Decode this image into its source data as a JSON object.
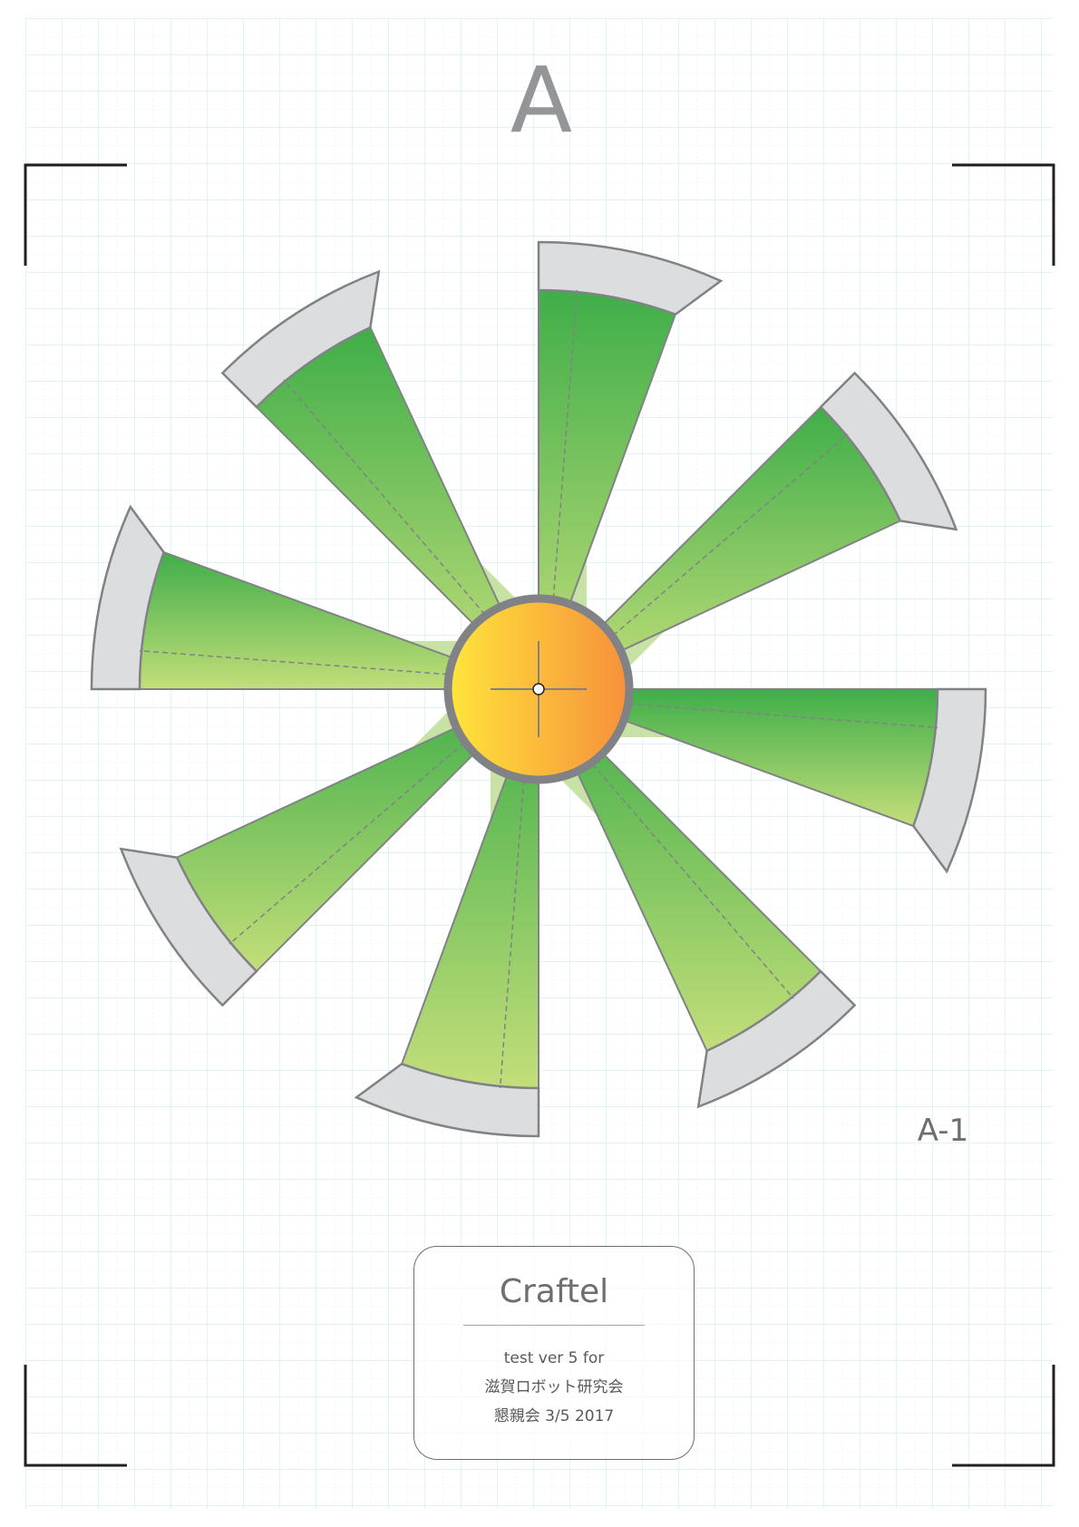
{
  "sheet_letter": "A",
  "part_id": "A-1",
  "label": {
    "title": "Craftel",
    "lines": [
      "test ver 5 for",
      "滋賀ロボット研究会",
      "懇親会 3/5 2017"
    ]
  },
  "pinwheel": {
    "blade_count": 8,
    "colors": {
      "blade_light": "#c8e2a6",
      "blade_gradient_dark": "#3fae49",
      "blade_gradient_light": "#c3de7a",
      "tab_fill": "#dcdddf",
      "outline": "#808285",
      "hub_gradient_left": "#ffe53b",
      "hub_gradient_right": "#f7903b",
      "hub_ring": "#808285",
      "grid_line": "#cfeef0",
      "crop_mark": "#231f20"
    },
    "icons": [
      "crosshair-icon"
    ]
  }
}
